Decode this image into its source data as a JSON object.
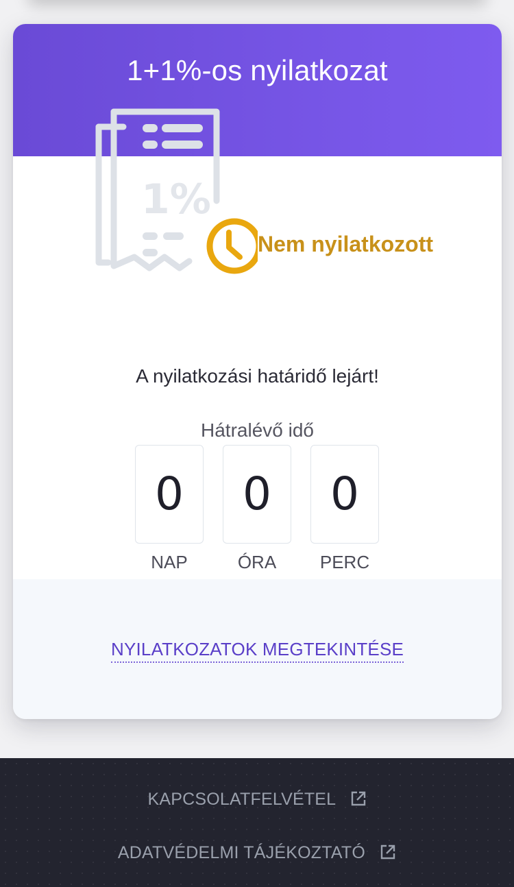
{
  "card": {
    "title": "1+1%-os nyilatkozat",
    "illustration_text": "1%",
    "status": "Nem nyilatkozott",
    "status_color": "#c8911a",
    "accent_color": "#7554e4",
    "message": "A nyilatkozási határidő lejárt!",
    "countdown_label": "Hátralévő idő",
    "countdown": [
      {
        "value": "0",
        "unit": "NAP"
      },
      {
        "value": "0",
        "unit": "ÓRA"
      },
      {
        "value": "0",
        "unit": "PERC"
      }
    ],
    "view_link": "NYILATKOZATOK MEGTEKINTÉSE"
  },
  "footer": {
    "links": [
      {
        "label": "KAPCSOLATFELVÉTEL",
        "icon": "external-link-icon"
      },
      {
        "label": "ADATVÉDELMI TÁJÉKOZTATÓ",
        "icon": "external-link-icon"
      }
    ]
  }
}
